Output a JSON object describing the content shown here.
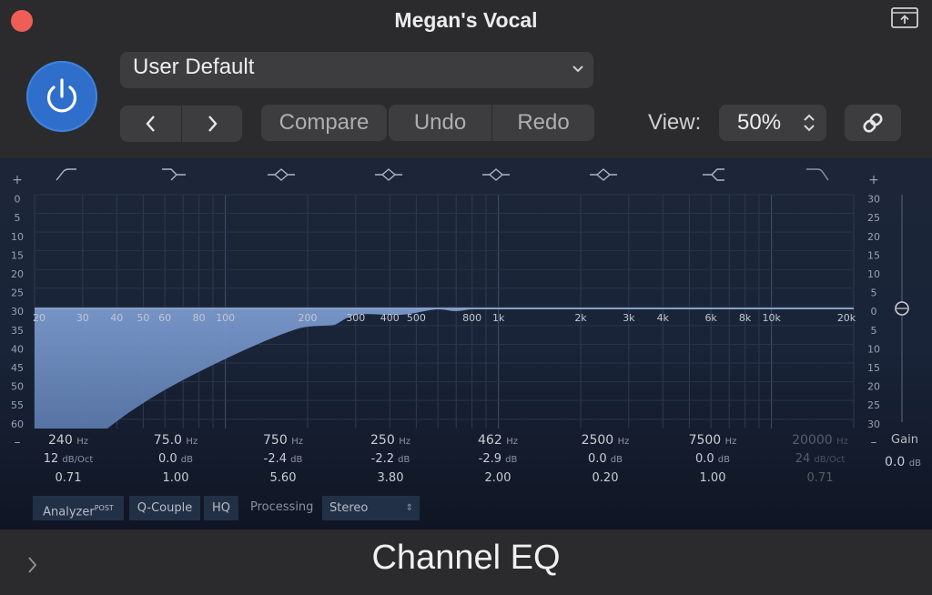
{
  "window": {
    "title": "Megan's Vocal"
  },
  "header": {
    "preset": "User Default",
    "compare_label": "Compare",
    "undo_label": "Undo",
    "redo_label": "Redo",
    "view_label": "View:",
    "view_value": "50%"
  },
  "graph": {
    "left_scale": [
      "+",
      "0",
      "5",
      "10",
      "15",
      "20",
      "25",
      "30",
      "35",
      "40",
      "45",
      "50",
      "55",
      "60",
      "–"
    ],
    "right_scale": [
      "+",
      "30",
      "25",
      "20",
      "15",
      "10",
      "5",
      "0",
      "5",
      "10",
      "15",
      "20",
      "25",
      "30",
      "–"
    ],
    "freq_labels": [
      "20",
      "30",
      "40",
      "50",
      "60",
      "80",
      "100",
      "200",
      "300",
      "400",
      "500",
      "800",
      "1k",
      "2k",
      "3k",
      "4k",
      "6k",
      "8k",
      "10k",
      "20k"
    ]
  },
  "bands": [
    {
      "freq": "240",
      "freq_unit": "Hz",
      "slope": "12",
      "slope_unit": "dB/Oct",
      "q": "0.71",
      "active": true,
      "icon": "low-cut-icon"
    },
    {
      "freq": "75.0",
      "freq_unit": "Hz",
      "slope": "0.0",
      "slope_unit": "dB",
      "q": "1.00",
      "active": true,
      "icon": "low-shelf-icon"
    },
    {
      "freq": "750",
      "freq_unit": "Hz",
      "slope": "-2.4",
      "slope_unit": "dB",
      "q": "5.60",
      "active": true,
      "icon": "bell-icon"
    },
    {
      "freq": "250",
      "freq_unit": "Hz",
      "slope": "-2.2",
      "slope_unit": "dB",
      "q": "3.80",
      "active": true,
      "icon": "bell-icon"
    },
    {
      "freq": "462",
      "freq_unit": "Hz",
      "slope": "-2.9",
      "slope_unit": "dB",
      "q": "2.00",
      "active": true,
      "icon": "bell-icon"
    },
    {
      "freq": "2500",
      "freq_unit": "Hz",
      "slope": "0.0",
      "slope_unit": "dB",
      "q": "0.20",
      "active": true,
      "icon": "bell-icon"
    },
    {
      "freq": "7500",
      "freq_unit": "Hz",
      "slope": "0.0",
      "slope_unit": "dB",
      "q": "1.00",
      "active": true,
      "icon": "high-shelf-icon"
    },
    {
      "freq": "20000",
      "freq_unit": "Hz",
      "slope": "24",
      "slope_unit": "dB/Oct",
      "q": "0.71",
      "active": false,
      "icon": "high-cut-icon"
    }
  ],
  "gain": {
    "label": "Gain",
    "value": "0.0",
    "unit": "dB"
  },
  "tools": {
    "analyzer": "Analyzer",
    "analyzer_sup": "POST",
    "qcouple": "Q-Couple",
    "hq": "HQ",
    "processing_label": "Processing",
    "processing_value": "Stereo"
  },
  "footer": {
    "plugin_name": "Channel EQ"
  },
  "colors": {
    "accent": "#2f6fcb",
    "close": "#ee5e57",
    "curve_fill": "#6e8fc2",
    "panel": "#12182a"
  }
}
